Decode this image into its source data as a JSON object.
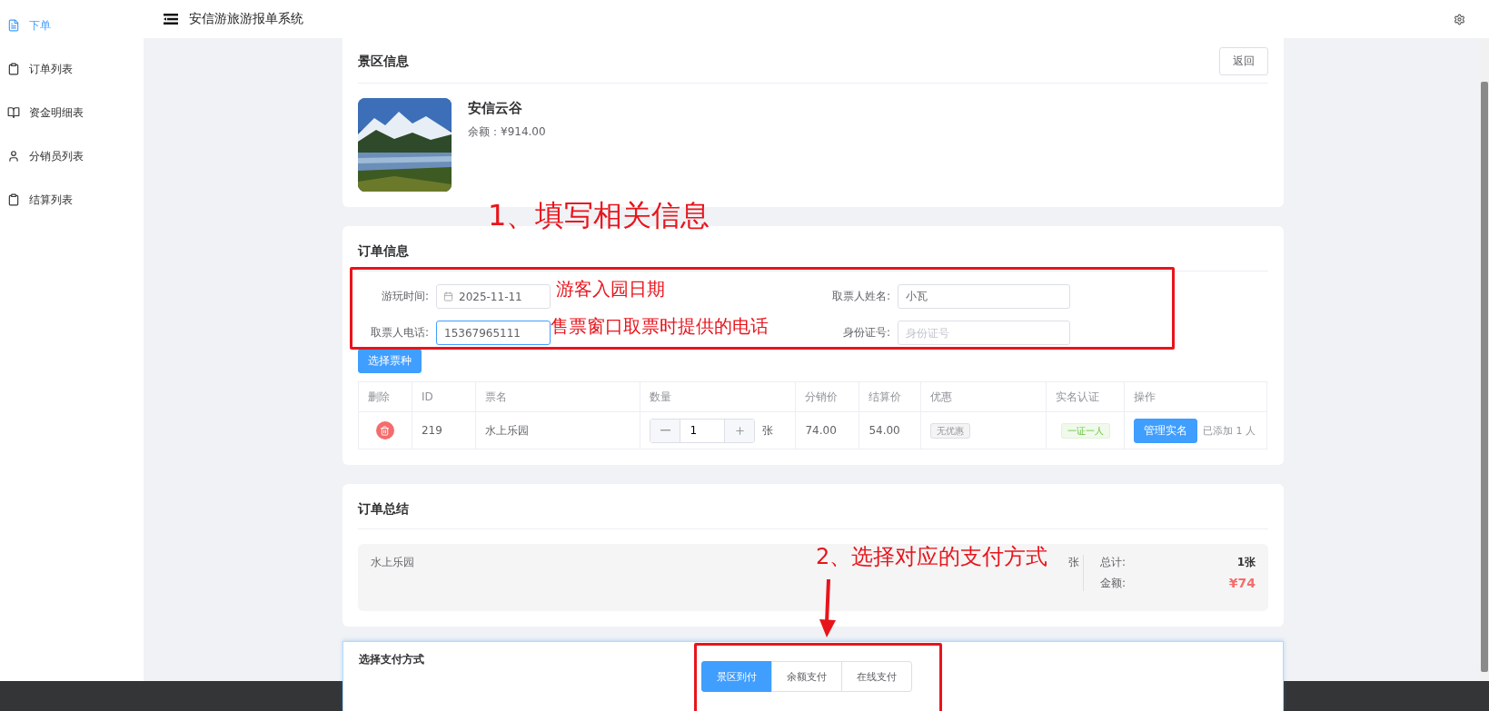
{
  "sidebar": {
    "items": [
      {
        "label": "下单",
        "selected": true,
        "kind": "doc"
      },
      {
        "label": "订单列表",
        "selected": false,
        "kind": "clipboard"
      },
      {
        "label": "资金明细表",
        "selected": false,
        "kind": "book"
      },
      {
        "label": "分销员列表",
        "selected": false,
        "kind": "user"
      },
      {
        "label": "结算列表",
        "selected": false,
        "kind": "clipboard"
      }
    ]
  },
  "header": {
    "title": "安信游旅游报单系统"
  },
  "scenic": {
    "title": "景区信息",
    "back_button": "返回",
    "name": "安信云谷",
    "balance": "余额：¥914.00"
  },
  "order": {
    "title": "订单信息",
    "fields": [
      {
        "label": "游玩时间:",
        "value": "2025-11-11",
        "kind": "date",
        "focused": false
      },
      {
        "label": "取票人姓名:",
        "value": "小瓦",
        "kind": "text",
        "focused": false
      },
      {
        "label": "取票人电话:",
        "value": "15367965111",
        "kind": "text",
        "focused": true
      },
      {
        "label": "身份证号:",
        "placeholder": "身份证号",
        "kind": "text",
        "focused": false
      }
    ],
    "choose_button": "选择票种",
    "table": {
      "columns": [
        "删除",
        "ID",
        "票名",
        "数量",
        "分销价",
        "结算价",
        "优惠",
        "实名认证",
        "操作"
      ],
      "rows": [
        {
          "id": "219",
          "name": "水上乐园",
          "quantity": "1",
          "unit": "张",
          "price": "74.00",
          "settle": "54.00",
          "discount": "无优惠",
          "realname": "一证一人",
          "action": "管理实名",
          "added": "已添加 1 人"
        }
      ]
    }
  },
  "summary": {
    "title": "订单总结",
    "item": "水上乐园",
    "item_count": "张",
    "total_label": "总计:",
    "total": "1张",
    "amount_label": "金额:",
    "amount": "¥74"
  },
  "payment": {
    "title": "选择支付方式",
    "options": [
      {
        "label": "景区到付",
        "selected": true
      },
      {
        "label": "余额支付",
        "selected": false
      },
      {
        "label": "在线支付",
        "selected": false
      }
    ]
  },
  "annotations": [
    {
      "text": "1、填写相关信息",
      "kind": "heading"
    },
    {
      "text": "游客入园日期",
      "kind": "note"
    },
    {
      "text": "售票窗口取票时提供的电话",
      "kind": "note"
    },
    {
      "text": "2、选择对应的支付方式",
      "kind": "heading"
    }
  ]
}
